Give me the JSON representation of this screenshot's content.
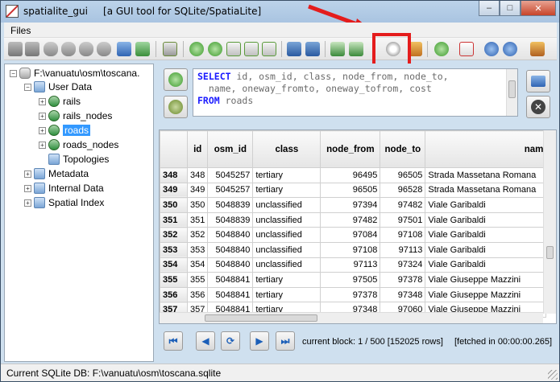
{
  "window": {
    "app_name": "spatialite_gui",
    "subtitle": "[a GUI tool for SQLite/SpatiaLite]",
    "minimize": "–",
    "maximize": "□",
    "close": "✕"
  },
  "menu": {
    "files": "Files"
  },
  "toolbar": {
    "icons": [
      "connect-icon",
      "disconnect-icon",
      "create-db-icon",
      "memory-db-icon",
      "memory-load-icon",
      "memory-save-icon",
      "vacuum-icon",
      "refresh-icon",
      "sql-script-icon",
      "load-shp-icon",
      "virtual-shp-icon",
      "load-txt-icon",
      "virtual-csv-icon",
      "load-dbf-icon",
      "load-xl-icon",
      "network-icon",
      "check-geometries-icon",
      "srids-icon",
      "map-preview-icon",
      "attach-db-icon",
      "sql-log-icon",
      "help-icon",
      "about-icon",
      "exit-icon"
    ],
    "highlight_color": "#e41c1c"
  },
  "tree": {
    "root": "F:\\vanuatu\\osm\\toscana.",
    "user_data": "User Data",
    "rails": "rails",
    "rails_nodes": "rails_nodes",
    "roads": "roads",
    "roads_nodes": "roads_nodes",
    "topologies": "Topologies",
    "metadata": "Metadata",
    "internal_data": "Internal Data",
    "spatial_index": "Spatial Index"
  },
  "sql": {
    "kw_select": "SELECT",
    "line1_rest": " id, osm_id, class, node_from, node_to,",
    "line2": "  name, oneway_fromto, oneway_tofrom, cost",
    "kw_from": "FROM",
    "line3_rest": " roads"
  },
  "grid": {
    "columns": [
      "id",
      "osm_id",
      "class",
      "node_from",
      "node_to",
      "nam"
    ],
    "rows": [
      {
        "row": "348",
        "id": "348",
        "osm_id": "5045257",
        "class": "tertiary",
        "node_from": "96495",
        "node_to": "96505",
        "name": "Strada Massetana Romana"
      },
      {
        "row": "349",
        "id": "349",
        "osm_id": "5045257",
        "class": "tertiary",
        "node_from": "96505",
        "node_to": "96528",
        "name": "Strada Massetana Romana"
      },
      {
        "row": "350",
        "id": "350",
        "osm_id": "5048839",
        "class": "unclassified",
        "node_from": "97394",
        "node_to": "97482",
        "name": "Viale Garibaldi"
      },
      {
        "row": "351",
        "id": "351",
        "osm_id": "5048839",
        "class": "unclassified",
        "node_from": "97482",
        "node_to": "97501",
        "name": "Viale Garibaldi"
      },
      {
        "row": "352",
        "id": "352",
        "osm_id": "5048840",
        "class": "unclassified",
        "node_from": "97084",
        "node_to": "97108",
        "name": "Viale Garibaldi"
      },
      {
        "row": "353",
        "id": "353",
        "osm_id": "5048840",
        "class": "unclassified",
        "node_from": "97108",
        "node_to": "97113",
        "name": "Viale Garibaldi"
      },
      {
        "row": "354",
        "id": "354",
        "osm_id": "5048840",
        "class": "unclassified",
        "node_from": "97113",
        "node_to": "97324",
        "name": "Viale Garibaldi"
      },
      {
        "row": "355",
        "id": "355",
        "osm_id": "5048841",
        "class": "tertiary",
        "node_from": "97505",
        "node_to": "97378",
        "name": "Viale Giuseppe Mazzini"
      },
      {
        "row": "356",
        "id": "356",
        "osm_id": "5048841",
        "class": "tertiary",
        "node_from": "97378",
        "node_to": "97348",
        "name": "Viale Giuseppe Mazzini"
      },
      {
        "row": "357",
        "id": "357",
        "osm_id": "5048841",
        "class": "tertiary",
        "node_from": "97348",
        "node_to": "97060",
        "name": "Viale Giuseppe Mazzini"
      }
    ]
  },
  "nav": {
    "first": "⏮",
    "prev": "◀",
    "refresh": "⟳",
    "next": "▶",
    "last": "⏭",
    "block_info": "current block: 1 / 500 [152025 rows]",
    "fetch_info": "[fetched in 00:00:00.265]"
  },
  "status": {
    "text": "Current SQLite DB: F:\\vanuatu\\osm\\toscana.sqlite"
  }
}
